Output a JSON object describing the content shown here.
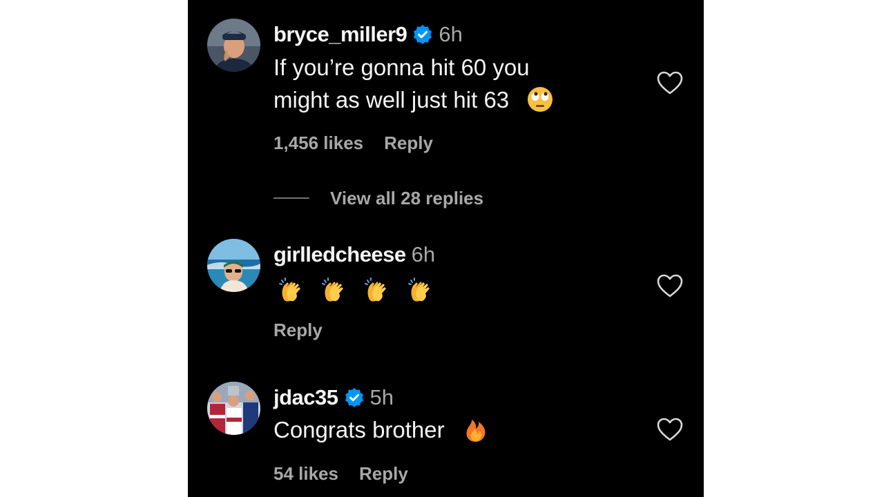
{
  "comments": [
    {
      "username": "bryce_miller9",
      "verified": true,
      "time": "6h",
      "text_lines": [
        "If you’re gonna hit 60 you",
        "might as well just hit 63"
      ],
      "emoji": "face-with-rolling-eyes",
      "likes": "1,456 likes",
      "reply": "Reply",
      "view_replies": "View all 28 replies"
    },
    {
      "username": "girlledcheese",
      "verified": false,
      "time": "6h",
      "emoji": "clapping-hands",
      "emoji_count": 4,
      "reply": "Reply"
    },
    {
      "username": "jdac35",
      "verified": true,
      "time": "5h",
      "text": "Congrats brother",
      "emoji": "fire",
      "likes": "54 likes",
      "reply": "Reply"
    }
  ],
  "colors": {
    "background": "#000000",
    "text": "#f5f5f5",
    "secondary": "#a8a8a8",
    "verified": "#0095f6"
  }
}
